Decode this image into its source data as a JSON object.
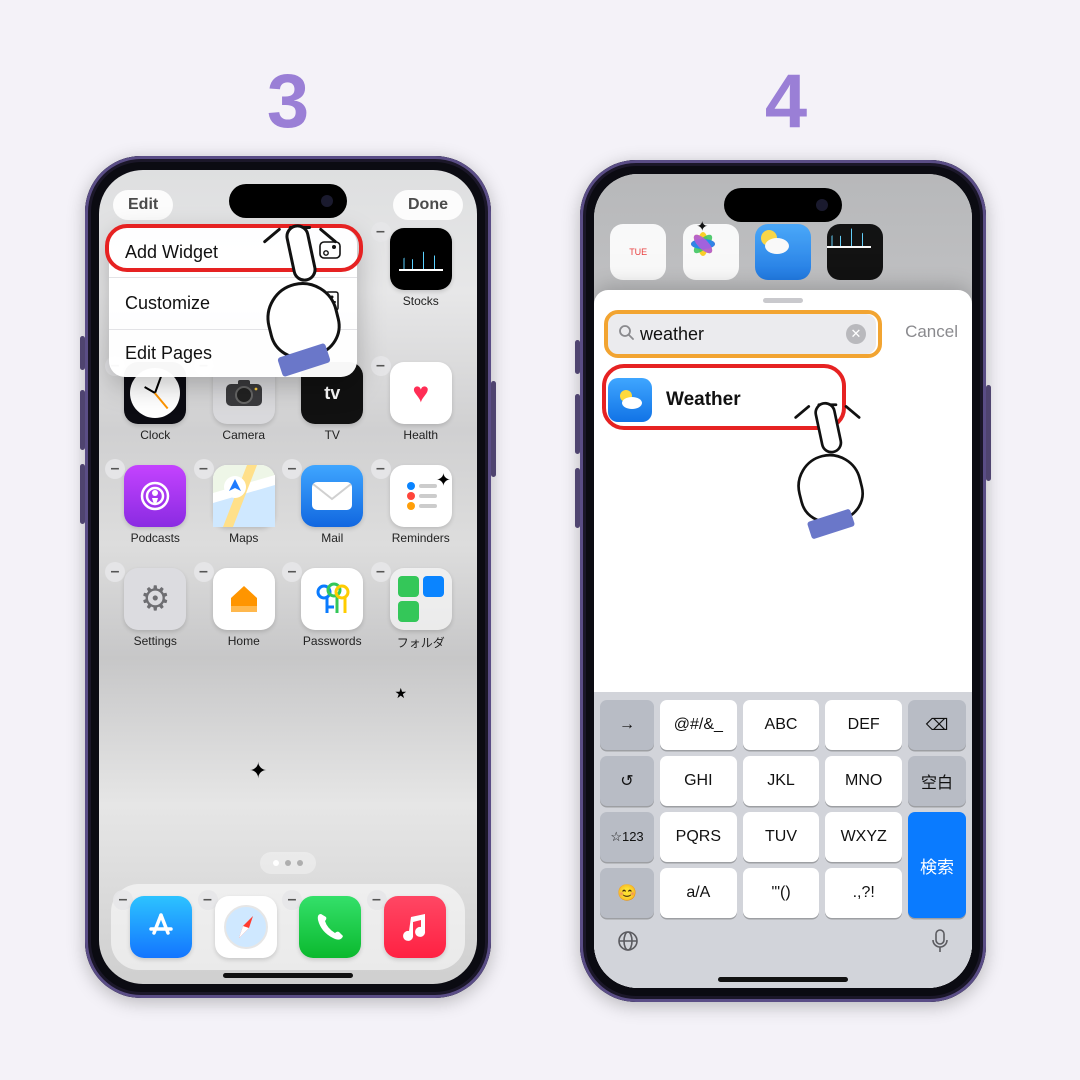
{
  "steps": {
    "s3": "3",
    "s4": "4"
  },
  "screen3": {
    "topbar": {
      "edit": "Edit",
      "done": "Done"
    },
    "menu": {
      "add_widget": "Add Widget",
      "customize": "Customize",
      "edit_pages": "Edit Pages"
    },
    "apps_row1": [
      {
        "label": "",
        "cls": ""
      },
      {
        "label": "",
        "cls": ""
      },
      {
        "label": "",
        "cls": ""
      },
      {
        "label": "Stocks",
        "cls": "c-stocks"
      }
    ],
    "apps_row2": [
      {
        "label": "Clock",
        "cls": "c-clock"
      },
      {
        "label": "Camera",
        "cls": "c-camera"
      },
      {
        "label": "TV",
        "cls": "c-tv"
      },
      {
        "label": "Health",
        "cls": "c-health"
      }
    ],
    "apps_row3": [
      {
        "label": "Podcasts",
        "cls": "c-pod"
      },
      {
        "label": "Maps",
        "cls": "c-maps"
      },
      {
        "label": "Mail",
        "cls": "c-mail"
      },
      {
        "label": "Reminders",
        "cls": "c-rem"
      }
    ],
    "apps_row4": [
      {
        "label": "Settings",
        "cls": "c-set"
      },
      {
        "label": "Home",
        "cls": "c-home"
      },
      {
        "label": "Passwords",
        "cls": "c-pwd"
      },
      {
        "label": "フォルダ",
        "cls": "c-fold"
      }
    ],
    "dock": [
      {
        "name": "appstore",
        "cls": "c-appst"
      },
      {
        "name": "safari",
        "cls": "c-safari"
      },
      {
        "name": "phone",
        "cls": "c-phone"
      },
      {
        "name": "music",
        "cls": "c-music"
      }
    ]
  },
  "screen4": {
    "cal_day": "TUE",
    "search_value": "weather",
    "cancel": "Cancel",
    "result_label": "Weather",
    "keyboard": {
      "row1": [
        "→",
        "@#/&_",
        "ABC",
        "DEF",
        "⌫"
      ],
      "row2": [
        "↺",
        "GHI",
        "JKL",
        "MNO",
        "空白"
      ],
      "row3": [
        "☆123",
        "PQRS",
        "TUV",
        "WXYZ",
        "検索"
      ],
      "row4": [
        "😊",
        "a/A",
        "'\"()",
        ".,?!",
        ""
      ]
    }
  }
}
